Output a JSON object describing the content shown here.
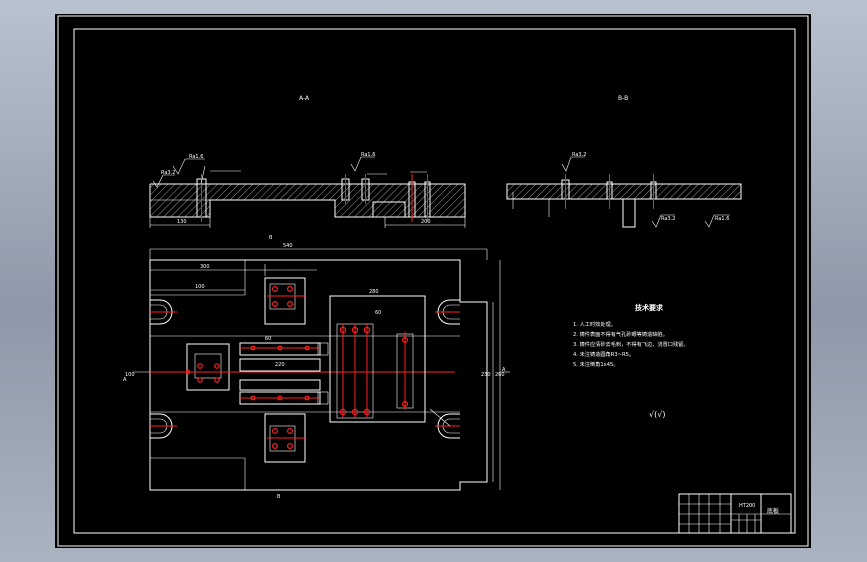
{
  "drawing": {
    "view_a_label": "A-A",
    "view_b_label": "B-B",
    "plan_label_top": "B",
    "plan_label_bottom": "B",
    "plan_label_left": "A",
    "plan_label_right": "A",
    "roughness_1": "Ra1.6",
    "roughness_2": "Ra3.2",
    "roughness_3": "Ra1.6",
    "roughness_4": "Ra3.2",
    "roughness_5": "Ra3.2",
    "roughness_6": "Ra1.6",
    "dim_left_130": "130",
    "dim_bottom_200": "200",
    "dim_overall_540": "540",
    "dim_300": "300",
    "dim_100": "100",
    "dim_220": "220",
    "dim_60": "60",
    "dim_280": "280",
    "dim_60b": "60",
    "dim_right_230": "230",
    "dim_right_260": "260",
    "dim_left_100": "100"
  },
  "notes": {
    "heading": "技术要求",
    "items": [
      "1. 人工时效处理。",
      "2. 铸件表面不得有气孔砂眼等铸造缺陷。",
      "3. 铸件应清砂去毛刺，不得有飞边、浇冒口残留。",
      "4. 未注铸造圆角R3~R5。",
      "5. 未注倒角1x45。"
    ],
    "roughness_other": "√(√)"
  },
  "title_block": {
    "part_name": "底板",
    "material": "HT200"
  }
}
